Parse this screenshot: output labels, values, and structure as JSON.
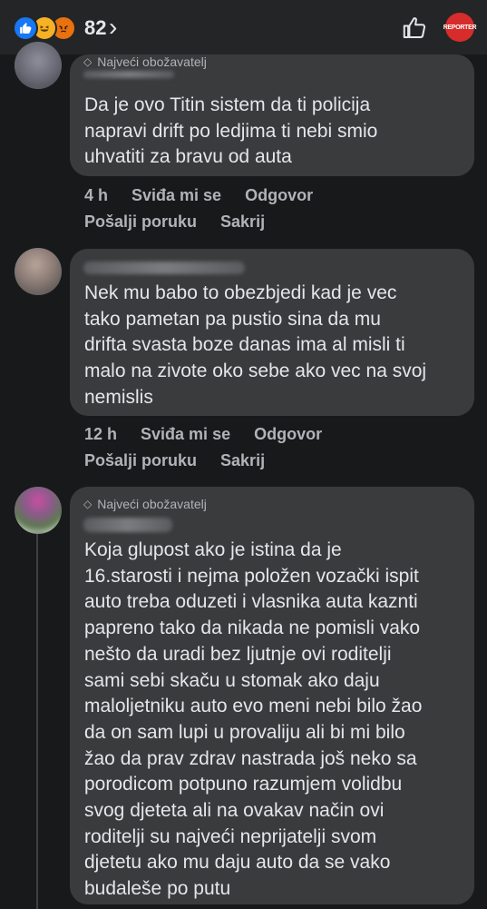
{
  "topbar": {
    "reaction_count": "82",
    "reaction_icons": [
      "like-icon",
      "haha-icon",
      "angry-icon"
    ],
    "chevron": "›",
    "brand_badge_text": "REPORTER"
  },
  "comments": [
    {
      "badge": "Najveći obožavatelj",
      "text": "Da je ovo Titin sistem da ti policija\nnapravi drift po ledjima ti nebi smio\nuhvatiti za bravu od auta",
      "time": "4 h",
      "like": "Sviđa mi se",
      "reply": "Odgovor",
      "message": "Pošalji poruku",
      "hide": "Sakrij"
    },
    {
      "text": "Nek mu babo to obezbjedi kad je vec\ntako pametan pa pustio sina da mu\ndrifta  svasta boze danas ima al misli ti\nmalo na zivote oko sebe ako vec na svoj\nnemislis",
      "time": "12 h",
      "like": "Sviđa mi se",
      "reply": "Odgovor",
      "message": "Pošalji poruku",
      "hide": "Sakrij"
    },
    {
      "badge": "Najveći obožavatelj",
      "text": "Koja glupost ako je istina da je\n16.starosti i nejma položen vozački ispit\nauto treba oduzeti i vlasnika auta kaznti\npapreno tako da nikada ne pomisli vako\nnešto da uradi bez ljutnje ovi roditelji\nsami sebi skaču u stomak ako daju\nmaloljetniku auto evo meni nebi bilo žao\nda on sam lupi u provaliju ali bi mi bilo\nžao da prav zdrav nastrada još neko sa\nporodicom potpuno razumjem volidbu\nsvog djeteta ali na ovakav način ovi\nroditelji su najveći neprijatelji svom\ndjetetu ako mu daju auto da se vako\nbudaleše po putu"
    }
  ],
  "colors": {
    "background": "#18191a",
    "bubble": "#3a3b3c",
    "text": "#e4e6eb",
    "secondary": "#b0b3b8",
    "like_blue": "#1877f2",
    "brand_red": "#d72c2c"
  }
}
